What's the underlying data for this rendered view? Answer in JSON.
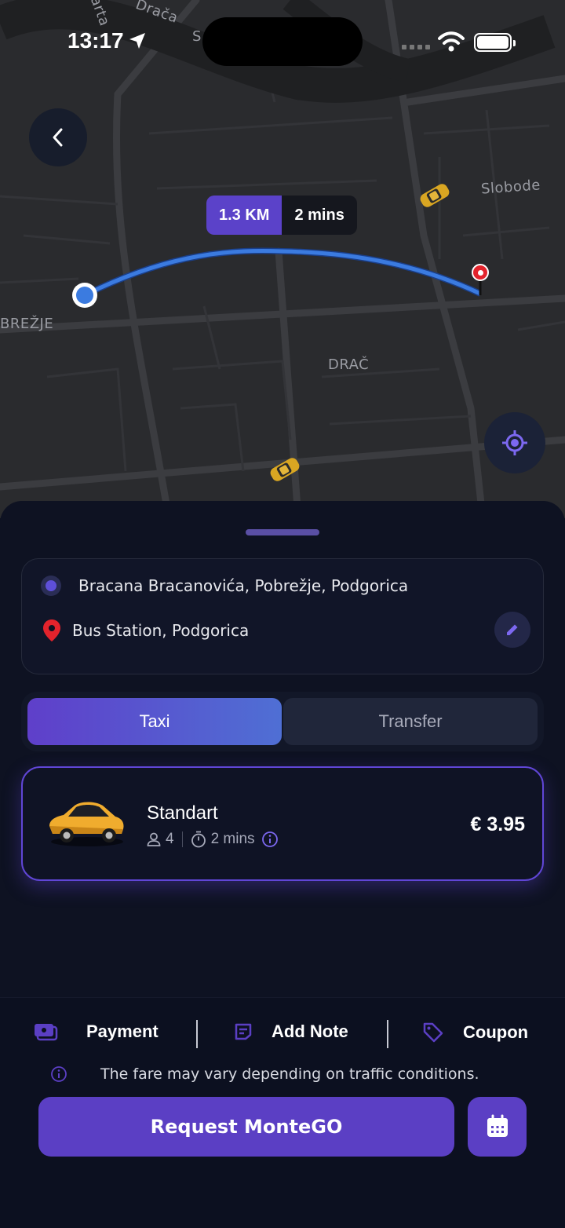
{
  "status_bar": {
    "time": "13:17"
  },
  "map": {
    "labels": {
      "area_left": "BREŽJE",
      "area_center": "DRAČ",
      "street_right": "Slobode",
      "street_top_a": "arta",
      "street_top_b": "Drača",
      "street_top_c": "S"
    },
    "route": {
      "distance": "1.3 KM",
      "duration": "2 mins"
    }
  },
  "addresses": {
    "pickup": "Bracana Bracanovića, Pobrežje, Podgorica",
    "destination": "Bus Station, Podgorica"
  },
  "tabs": [
    {
      "label": "Taxi",
      "active": true
    },
    {
      "label": "Transfer",
      "active": false
    }
  ],
  "ride": {
    "name": "Standart",
    "seats": "4",
    "eta": "2 mins",
    "price": "€ 3.95"
  },
  "footer": {
    "payment_label": "Payment",
    "note_label": "Add Note",
    "coupon_label": "Coupon",
    "fare_note": "The fare may vary depending on traffic conditions.",
    "request_label": "Request MonteGO"
  },
  "colors": {
    "accent": "#5b3fc4",
    "route": "#3b7be0",
    "pin": "#e3232c",
    "map_bg": "#2a2b2e"
  },
  "icons": [
    "location-arrow-icon",
    "signal-icon",
    "wifi-icon",
    "battery-icon",
    "back-chevron-icon",
    "taxi-car-icon",
    "locate-icon",
    "destination-pin-icon",
    "edit-icon",
    "person-icon",
    "timer-icon",
    "info-icon",
    "payment-icon",
    "note-icon",
    "coupon-tag-icon",
    "calendar-icon"
  ]
}
